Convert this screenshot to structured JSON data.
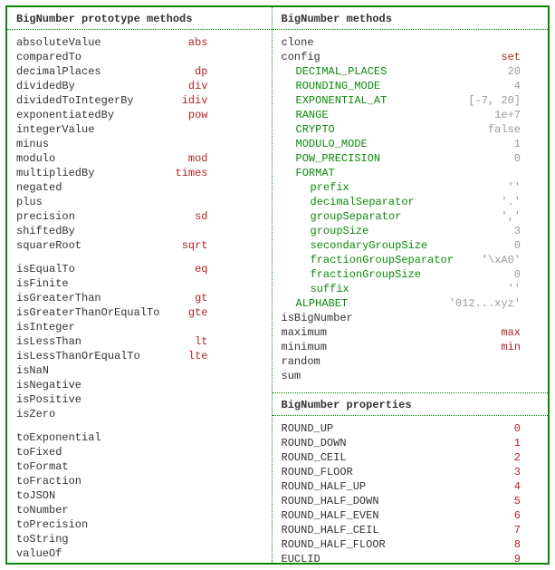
{
  "left": {
    "heading": "BigNumber prototype methods",
    "groups": [
      [
        {
          "name": "absoluteValue",
          "alias": "abs"
        },
        {
          "name": "comparedTo"
        },
        {
          "name": "decimalPlaces",
          "alias": "dp"
        },
        {
          "name": "dividedBy",
          "alias": "div"
        },
        {
          "name": "dividedToIntegerBy",
          "alias": "idiv"
        },
        {
          "name": "exponentiatedBy",
          "alias": "pow"
        },
        {
          "name": "integerValue"
        },
        {
          "name": "minus"
        },
        {
          "name": "modulo",
          "alias": "mod"
        },
        {
          "name": "multipliedBy",
          "alias": "times"
        },
        {
          "name": "negated"
        },
        {
          "name": "plus"
        },
        {
          "name": "precision",
          "alias": "sd"
        },
        {
          "name": "shiftedBy"
        },
        {
          "name": "squareRoot",
          "alias": "sqrt"
        }
      ],
      [
        {
          "name": "isEqualTo",
          "alias": "eq"
        },
        {
          "name": "isFinite"
        },
        {
          "name": "isGreaterThan",
          "alias": "gt"
        },
        {
          "name": "isGreaterThanOrEqualTo",
          "alias": "gte"
        },
        {
          "name": "isInteger"
        },
        {
          "name": "isLessThan",
          "alias": "lt"
        },
        {
          "name": "isLessThanOrEqualTo",
          "alias": "lte"
        },
        {
          "name": "isNaN"
        },
        {
          "name": "isNegative"
        },
        {
          "name": "isPositive"
        },
        {
          "name": "isZero"
        }
      ],
      [
        {
          "name": "toExponential"
        },
        {
          "name": "toFixed"
        },
        {
          "name": "toFormat"
        },
        {
          "name": "toFraction"
        },
        {
          "name": "toJSON"
        },
        {
          "name": "toNumber"
        },
        {
          "name": "toPrecision"
        },
        {
          "name": "toString"
        },
        {
          "name": "valueOf"
        }
      ]
    ]
  },
  "right": {
    "methods": {
      "heading": "BigNumber methods",
      "pre": [
        {
          "name": "clone"
        },
        {
          "name": "config",
          "alias": "set"
        }
      ],
      "config": [
        {
          "key": "DECIMAL_PLACES",
          "value": "20",
          "indent": 1
        },
        {
          "key": "ROUNDING_MODE",
          "value": "4",
          "indent": 1
        },
        {
          "key": "EXPONENTIAL_AT",
          "value": "[-7, 20]",
          "indent": 1
        },
        {
          "key": "RANGE",
          "value": "1e+7",
          "indent": 1
        },
        {
          "key": "CRYPTO",
          "value": "false",
          "indent": 1
        },
        {
          "key": "MODULO_MODE",
          "value": "1",
          "indent": 1
        },
        {
          "key": "POW_PRECISION",
          "value": "0",
          "indent": 1
        },
        {
          "key": "FORMAT",
          "indent": 1
        },
        {
          "key": "prefix",
          "value": "''",
          "indent": 2
        },
        {
          "key": "decimalSeparator",
          "value": "'.'",
          "indent": 2
        },
        {
          "key": "groupSeparator",
          "value": "','",
          "indent": 2
        },
        {
          "key": "groupSize",
          "value": "3",
          "indent": 2
        },
        {
          "key": "secondaryGroupSize",
          "value": "0",
          "indent": 2
        },
        {
          "key": "fractionGroupSeparator",
          "value": "'\\xA0'",
          "indent": 2
        },
        {
          "key": "fractionGroupSize",
          "value": "0",
          "indent": 2
        },
        {
          "key": "suffix",
          "value": "''",
          "indent": 2
        },
        {
          "key": "ALPHABET",
          "value": "'012...xyz'",
          "indent": 1
        }
      ],
      "post": [
        {
          "name": "isBigNumber"
        },
        {
          "name": "maximum",
          "alias": "max"
        },
        {
          "name": "minimum",
          "alias": "min"
        },
        {
          "name": "random"
        },
        {
          "name": "sum"
        }
      ]
    },
    "properties": {
      "heading": "BigNumber properties",
      "items": [
        {
          "name": "ROUND_UP",
          "value": "0"
        },
        {
          "name": "ROUND_DOWN",
          "value": "1"
        },
        {
          "name": "ROUND_CEIL",
          "value": "2"
        },
        {
          "name": "ROUND_FLOOR",
          "value": "3"
        },
        {
          "name": "ROUND_HALF_UP",
          "value": "4"
        },
        {
          "name": "ROUND_HALF_DOWN",
          "value": "5"
        },
        {
          "name": "ROUND_HALF_EVEN",
          "value": "6"
        },
        {
          "name": "ROUND_HALF_CEIL",
          "value": "7"
        },
        {
          "name": "ROUND_HALF_FLOOR",
          "value": "8"
        },
        {
          "name": "EUCLID",
          "value": "9"
        }
      ]
    }
  }
}
